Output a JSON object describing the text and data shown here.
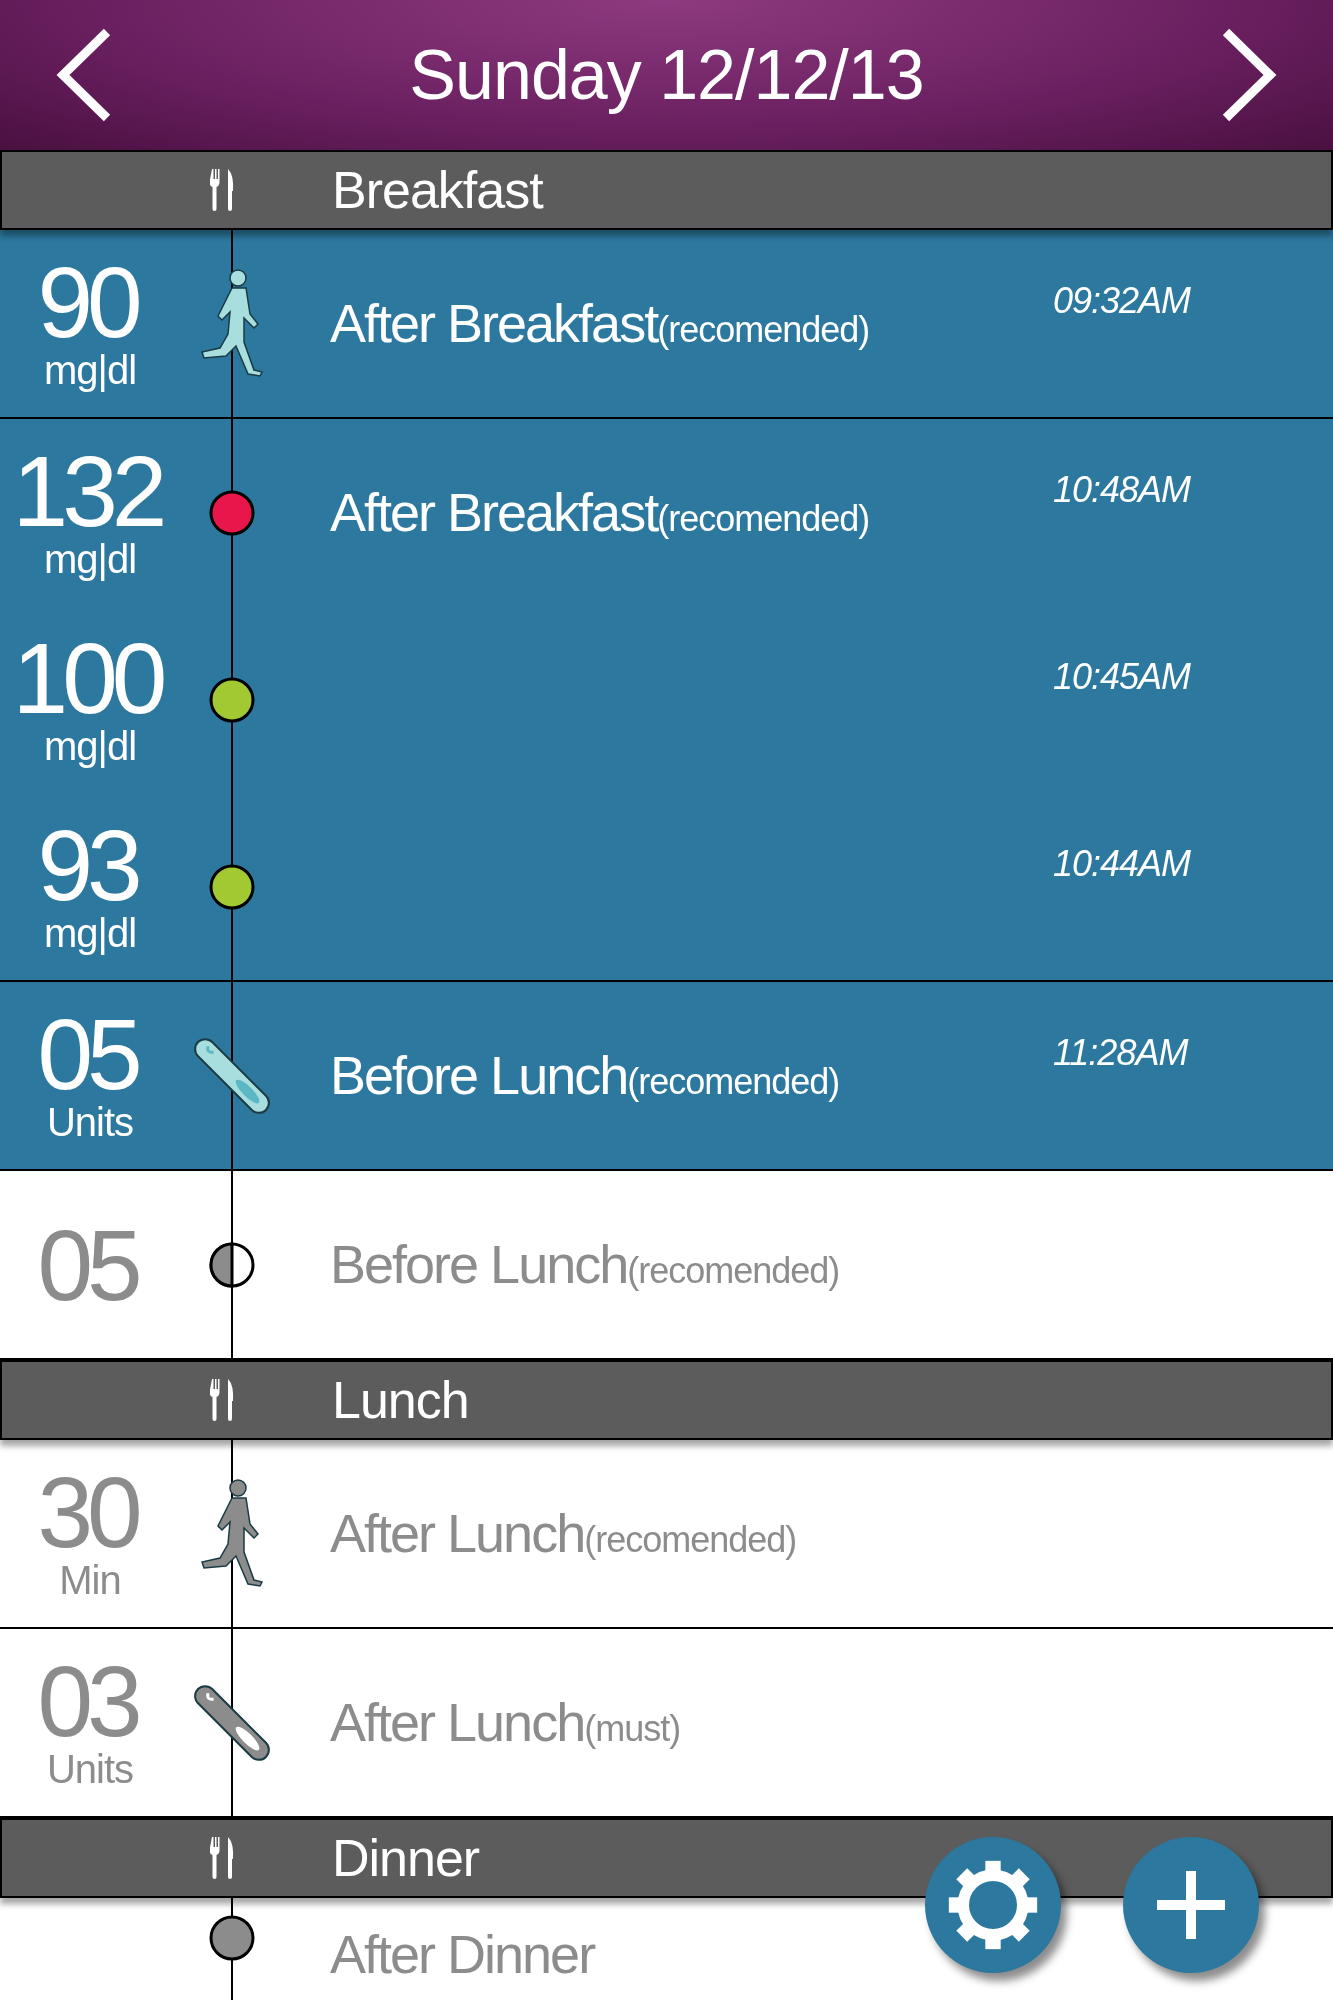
{
  "header": {
    "title": "Sunday 12/12/13"
  },
  "timeline": [
    {
      "kind": "meal",
      "label": "Breakfast"
    },
    {
      "kind": "block",
      "active": true,
      "readings": [
        {
          "value": "90",
          "unit": "mg|dl",
          "kind": "runner",
          "title": "After Breakfast",
          "note": "(recomended)",
          "time": "09:32AM"
        }
      ]
    },
    {
      "kind": "block",
      "active": true,
      "readings": [
        {
          "value": "132",
          "unit": "mg|dl",
          "kind": "dot",
          "color": "#e8164a",
          "title": "After Breakfast",
          "note": "(recomended)",
          "time": "10:48AM"
        },
        {
          "value": "100",
          "unit": "mg|dl",
          "kind": "dot",
          "color": "#a3c932",
          "time": "10:45AM"
        },
        {
          "value": "93",
          "unit": "mg|dl",
          "kind": "dot",
          "color": "#a3c932",
          "time": "10:44AM"
        }
      ]
    },
    {
      "kind": "block",
      "active": true,
      "readings": [
        {
          "value": "05",
          "unit": "Units",
          "kind": "syringe",
          "title": "Before Lunch",
          "note": "(recomended)",
          "time": "11:28AM"
        }
      ]
    },
    {
      "kind": "block",
      "active": false,
      "readings": [
        {
          "value": "05",
          "kind": "half",
          "title": "Before Lunch",
          "note": "(recomended)"
        }
      ]
    },
    {
      "kind": "meal",
      "label": "Lunch"
    },
    {
      "kind": "block",
      "active": false,
      "readings": [
        {
          "value": "30",
          "unit": "Min",
          "kind": "runner",
          "title": "After Lunch",
          "note": "(recomended)"
        }
      ]
    },
    {
      "kind": "block",
      "active": false,
      "readings": [
        {
          "value": "03",
          "unit": "Units",
          "kind": "syringe",
          "title": "After Lunch",
          "note": "(must)"
        }
      ]
    },
    {
      "kind": "meal",
      "label": "Dinner"
    },
    {
      "kind": "block",
      "active": false,
      "readings": [
        {
          "kind": "dot",
          "color": "#8c8c8c",
          "title": "After Dinner"
        }
      ]
    }
  ]
}
